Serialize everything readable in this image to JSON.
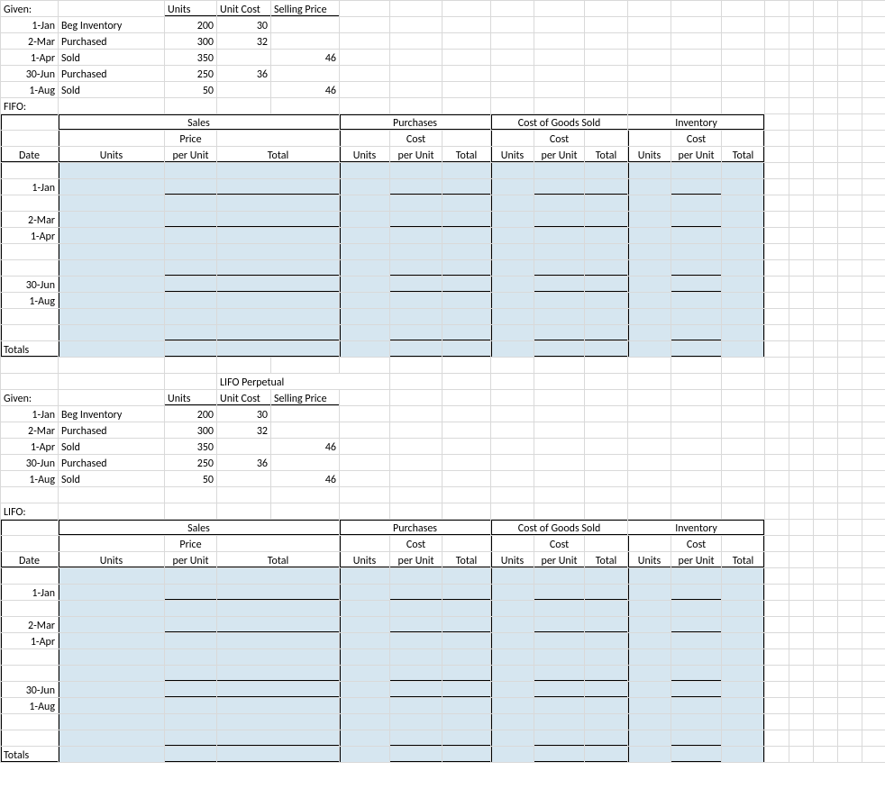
{
  "labels": {
    "given": "Given:",
    "units": "Units",
    "unit_cost": "Unit Cost",
    "selling_price": "Selling Price",
    "fifo": "FIFO:",
    "lifo_perpetual": "LIFO Perpetual",
    "lifo": "LIFO:",
    "date": "Date",
    "totals": "Totals",
    "sales": "Sales",
    "purchases": "Purchases",
    "cogs": "Cost of Goods Sold",
    "inventory": "Inventory",
    "price": "Price",
    "cost": "Cost",
    "per_unit": "per Unit",
    "total": "Total"
  },
  "given_rows": [
    {
      "date": "1-Jan",
      "desc": "Beg Inventory",
      "units": "200",
      "unit_cost": "30",
      "selling_price": ""
    },
    {
      "date": "2-Mar",
      "desc": "Purchased",
      "units": "300",
      "unit_cost": "32",
      "selling_price": ""
    },
    {
      "date": "1-Apr",
      "desc": "Sold",
      "units": "350",
      "unit_cost": "",
      "selling_price": "46"
    },
    {
      "date": "30-Jun",
      "desc": "Purchased",
      "units": "250",
      "unit_cost": "36",
      "selling_price": ""
    },
    {
      "date": "1-Aug",
      "desc": "Sold",
      "units": "50",
      "unit_cost": "",
      "selling_price": "46"
    }
  ],
  "block_dates": [
    "1-Jan",
    "2-Mar",
    "1-Apr",
    "30-Jun",
    "1-Aug"
  ]
}
